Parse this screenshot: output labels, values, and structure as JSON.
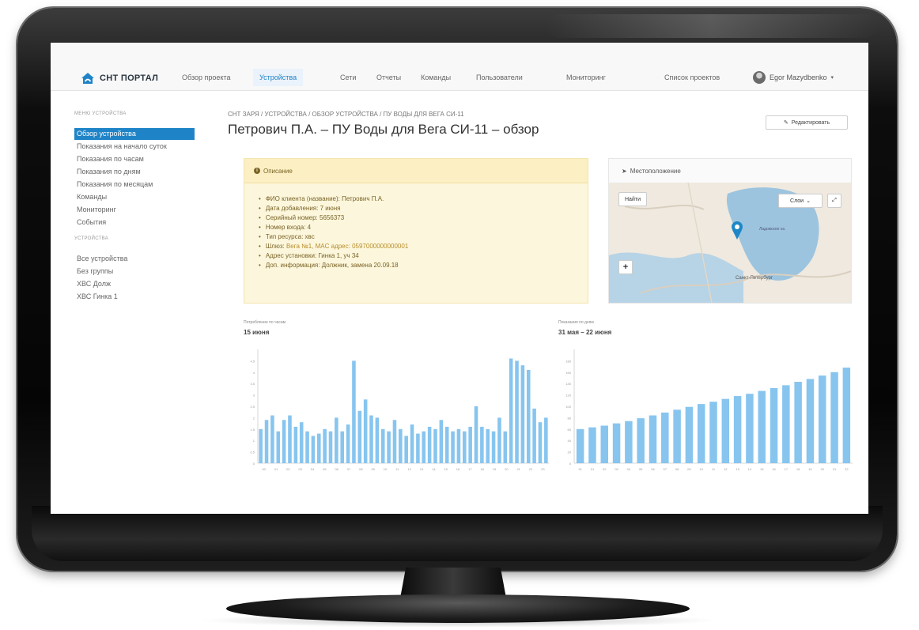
{
  "nav": {
    "logo": "СНТ ПОРТАЛ",
    "items": [
      "Обзор проекта",
      "Устройства",
      "Сети",
      "Отчеты",
      "Команды",
      "Пользователи",
      "Мониторинг"
    ],
    "active_index": 1,
    "projects_link": "Список проектов",
    "user_name": "Egor Mazydbenko",
    "accent_color": "#1f84c7"
  },
  "sidebar": {
    "section1_title": "МЕНЮ УСТРОЙСТВА",
    "menu": [
      "Обзор устройства",
      "Показания на начало суток",
      "Показания по часам",
      "Показания по дням",
      "Показания по месяцам",
      "Команды",
      "Мониторинг",
      "События"
    ],
    "section2_title": "УСТРОЙСТВА",
    "devices": [
      "Все устройства",
      "Без группы",
      "ХВС Долж",
      "ХВС Гинка 1"
    ]
  },
  "breadcrumb": "СНТ ЗАРЯ / УСТРОЙСТВА / ОБЗОР УСТРОЙСТВА / ПУ ВОДЫ ДЛЯ ВЕГА СИ-11",
  "page_title": "Петрович П.А. – ПУ Воды для Вега СИ-11 – обзор",
  "edit_button": "Редактировать",
  "description": {
    "title": "Описание",
    "items": [
      {
        "label": "ФИО клиента (название):",
        "value": "Петрович П.А."
      },
      {
        "label": "Дата добавления:",
        "value": "7 июня"
      },
      {
        "label": "Серийный номер:",
        "value": "5656373"
      },
      {
        "label": "Номер входа:",
        "value": "4"
      },
      {
        "label": "Тип ресурса:",
        "value": "хвс"
      },
      {
        "label": "Шлюз:",
        "value": "Вега №1, MAC адрес: 0597000000000001"
      },
      {
        "label": "Адрес установки:",
        "value": "Гинка 1, уч 34"
      },
      {
        "label": "Доп. информация:",
        "value": "Должник, замена 20.09.18"
      }
    ]
  },
  "map": {
    "title": "Местоположение",
    "find_button": "Найти",
    "layers_button": "Слои",
    "city_label": "Санкт-Петербург",
    "lake_label": "Ладожское оз."
  },
  "chart_data": [
    {
      "type": "bar",
      "caption": "Потребление по часам",
      "subtitle": "15 июня",
      "bar_color": "#87c5ef",
      "ylim": [
        0,
        5
      ],
      "x": [
        "00",
        "01",
        "02",
        "03",
        "04",
        "05",
        "06",
        "07",
        "08",
        "09",
        "10",
        "11",
        "12",
        "13",
        "14",
        "15",
        "16",
        "17",
        "18",
        "19",
        "20",
        "21",
        "22",
        "23"
      ],
      "values": [
        1.5,
        1.9,
        2.1,
        1.4,
        1.9,
        2.1,
        1.6,
        1.8,
        1.4,
        1.2,
        1.3,
        1.5,
        1.4,
        2.0,
        1.4,
        1.7,
        4.5,
        2.3,
        2.8,
        2.1,
        2.0,
        1.5,
        1.4,
        1.9,
        1.5,
        1.2,
        1.7,
        1.3,
        1.4,
        1.6,
        1.5,
        1.9,
        1.6,
        1.4,
        1.5,
        1.4,
        1.6,
        2.5,
        1.6,
        1.5,
        1.4,
        2.0,
        1.4,
        4.6,
        4.5,
        4.3,
        4.1,
        2.4,
        1.8,
        2.0
      ],
      "yticks": [
        "0",
        "0.5",
        "1",
        "1.5",
        "2",
        "2.5",
        "3",
        "3.5",
        "4",
        "4.5"
      ]
    },
    {
      "type": "bar",
      "caption": "Показания по дням",
      "subtitle": "31 мая – 22 июня",
      "bar_color": "#87c5ef",
      "ylim": [
        0,
        200
      ],
      "x": [
        "31",
        "01",
        "02",
        "03",
        "04",
        "05",
        "06",
        "07",
        "08",
        "09",
        "10",
        "11",
        "12",
        "13",
        "14",
        "15",
        "16",
        "17",
        "18",
        "19",
        "20",
        "21",
        "22"
      ],
      "values": [
        60,
        63,
        66,
        70,
        74,
        79,
        84,
        89,
        94,
        99,
        104,
        108,
        113,
        118,
        122,
        127,
        132,
        137,
        143,
        148,
        154,
        160,
        168
      ],
      "yticks": [
        "0",
        "20",
        "40",
        "60",
        "80",
        "100",
        "120",
        "140",
        "160",
        "180"
      ]
    }
  ]
}
